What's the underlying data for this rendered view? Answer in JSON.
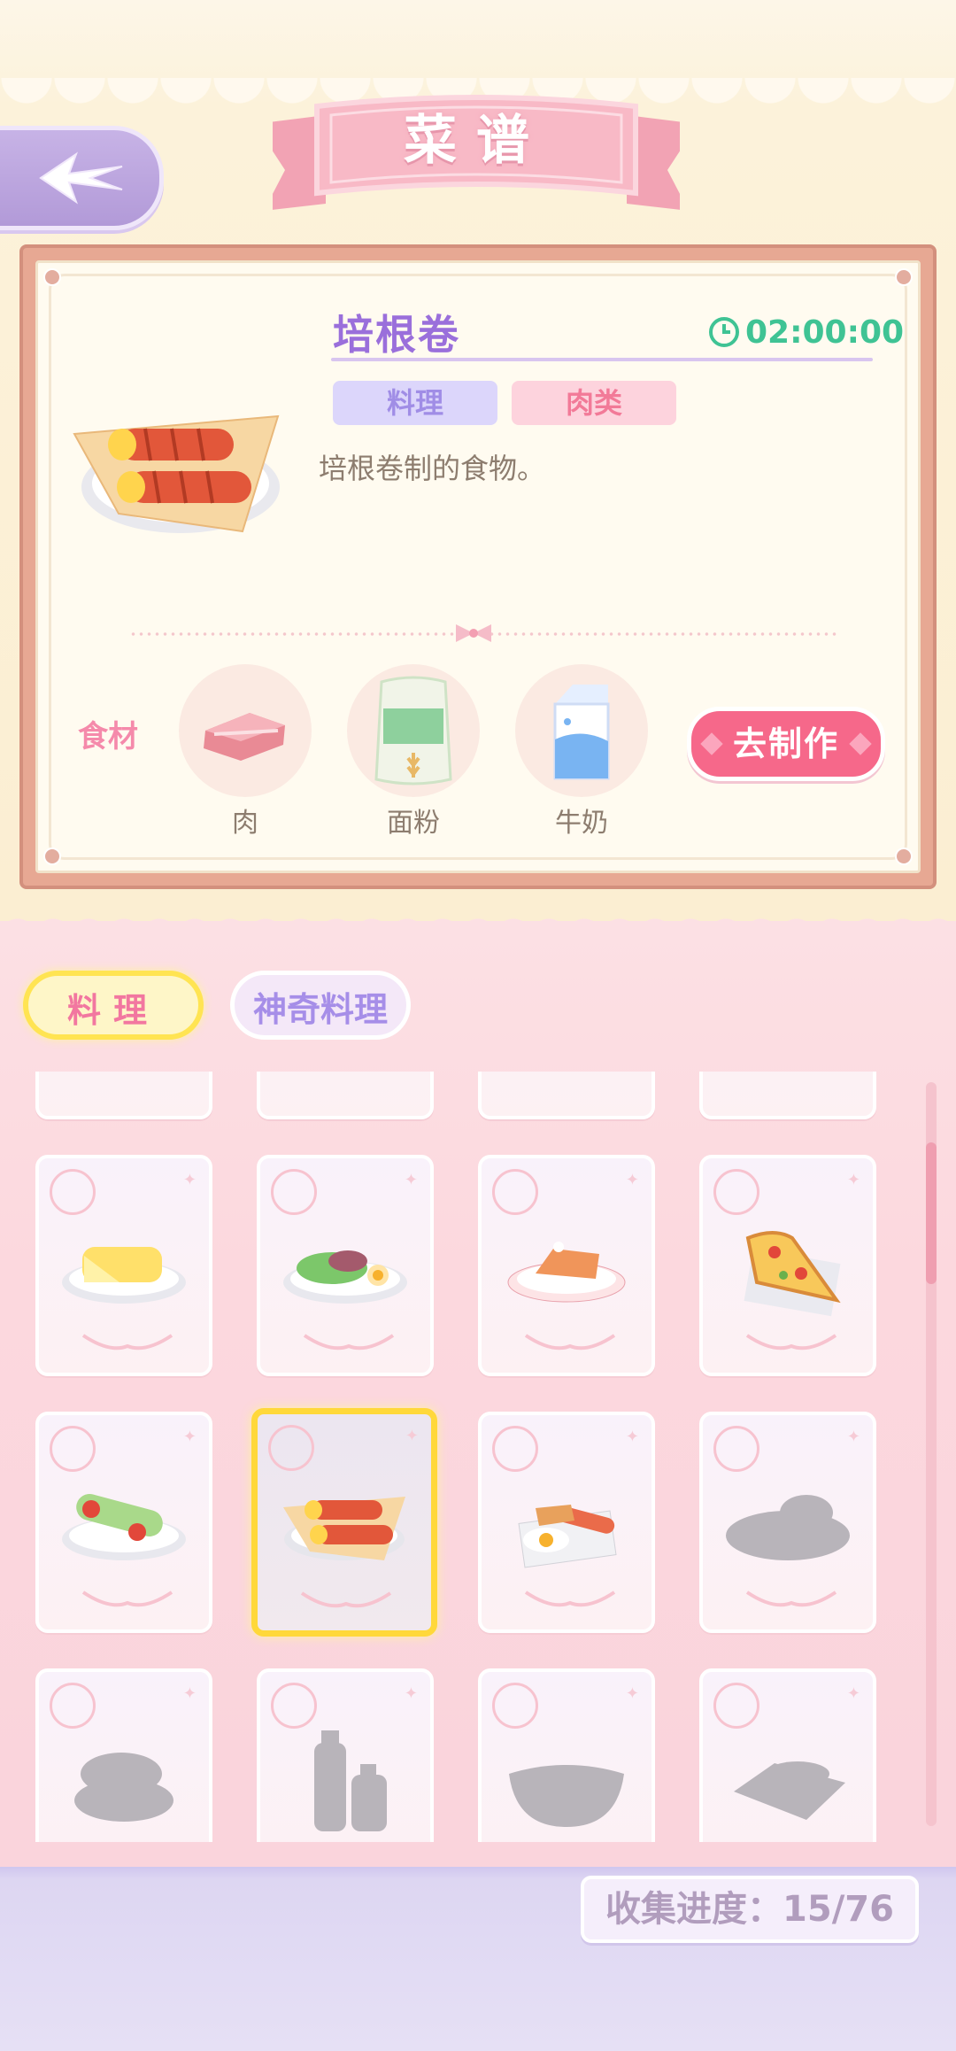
{
  "header": {
    "title": "菜谱"
  },
  "detail": {
    "name": "培根卷",
    "timer": "02:00:00",
    "tags": [
      "料理",
      "肉类"
    ],
    "description": "培根卷制的食物。",
    "ingredients_label": "食材",
    "ingredients": [
      {
        "name": "肉",
        "icon": "meat-icon"
      },
      {
        "name": "面粉",
        "icon": "flour-bag-icon"
      },
      {
        "name": "牛奶",
        "icon": "milk-carton-icon"
      }
    ],
    "make_button": "去制作"
  },
  "category_tabs": [
    {
      "label": "料理",
      "active": true
    },
    {
      "label": "神奇料理",
      "active": false
    }
  ],
  "recipes_visible": [
    {
      "icon": "cheese-omelette-icon",
      "unlocked": true
    },
    {
      "icon": "salad-platter-icon",
      "unlocked": true
    },
    {
      "icon": "cake-slice-icon",
      "unlocked": true
    },
    {
      "icon": "pizza-slice-icon",
      "unlocked": true
    },
    {
      "icon": "veggie-wrap-icon",
      "unlocked": true
    },
    {
      "icon": "bacon-roll-icon",
      "unlocked": true,
      "selected": true
    },
    {
      "icon": "breakfast-plate-icon",
      "unlocked": true
    },
    {
      "icon": "locked-dish-icon",
      "unlocked": false
    },
    {
      "icon": "locked-pancake-icon",
      "unlocked": false
    },
    {
      "icon": "locked-bottles-icon",
      "unlocked": false
    },
    {
      "icon": "locked-bowl-icon",
      "unlocked": false
    },
    {
      "icon": "locked-tray-icon",
      "unlocked": false
    }
  ],
  "progress": {
    "text": "收集进度：15/76",
    "collected": 15,
    "total": 76
  },
  "colors": {
    "accent_pink": "#f6688a",
    "title_purple": "#9a6fdb",
    "timer_green": "#3fc394",
    "selected_gold": "#ffd83a"
  }
}
